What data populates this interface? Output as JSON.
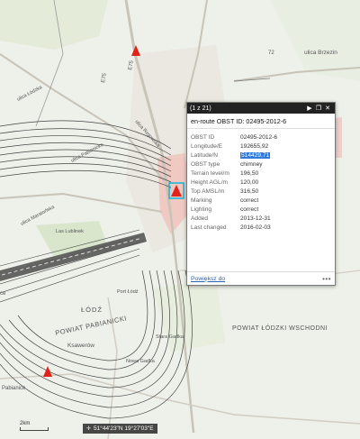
{
  "popup": {
    "counter": "(1 z 21)",
    "title": "en-route OBST ID: 02495-2012-6",
    "attributes": [
      {
        "key": "OBST ID",
        "value": "02495-2012-6"
      },
      {
        "key": "Longitude/E",
        "value": "192655,92"
      },
      {
        "key": "Latitude/N",
        "value": "514429,71",
        "selected": true
      },
      {
        "key": "OBST type",
        "value": "chimney"
      },
      {
        "key": "Terrain level/m",
        "value": "196,50"
      },
      {
        "key": "Height AGL/m",
        "value": "120,00"
      },
      {
        "key": "Top AMSL/m",
        "value": "316,50"
      },
      {
        "key": "Marking",
        "value": "correct"
      },
      {
        "key": "Lighting",
        "value": "correct"
      },
      {
        "key": "Added",
        "value": "2013-12-31"
      },
      {
        "key": "Last changed",
        "value": "2016-02-03"
      }
    ],
    "zoom_link": "Powiększ do",
    "more": "•••",
    "buttons": {
      "play": "▶",
      "maximize": "❐",
      "close": "✕"
    }
  },
  "map_labels": {
    "ulica_brzezinska": "ulica Brzezin",
    "e75_top": "E75",
    "e75_left": "E75",
    "n72": "72",
    "ulica_lodzka": "ulica Łódzka",
    "ulica_rzgowska": "ulica Rzgowska",
    "ulica_maratonska": "ulica Maratońska",
    "ulica_pabianicka": "ulica Pabianicka",
    "las_lublinek": "Las Lublinek",
    "lodz": "ŁÓDŹ",
    "powiat_pabianicki": "POWIAT PABIANICKI",
    "powiat_lodzki_wschodni": "POWIAT ŁÓDZKI WSCHODNI",
    "ksawerow": "Ksawerów",
    "nowa_gadka": "Nowa Gadka",
    "stara_gadka": "Stara Gadka",
    "port_lodz": "Port Łódź",
    "pabianice": "Pabianice",
    "ce": "ce"
  },
  "coordinates": "51°44'23\"N 19°27'03\"E",
  "scale": "2km",
  "colors": {
    "obstacle": "#e0241b",
    "highlight": "#00b4d8",
    "zone": "#f2b8b4",
    "popup_header": "#222222",
    "link": "#2a62b8"
  }
}
